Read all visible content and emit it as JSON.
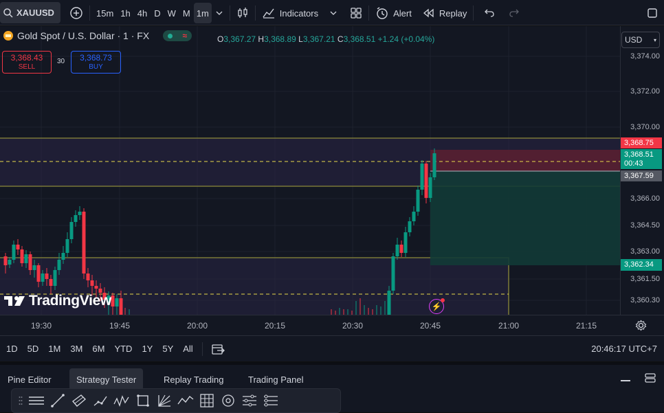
{
  "toolbar": {
    "symbol": "XAUUSD",
    "intervals": [
      "15m",
      "1h",
      "4h",
      "D",
      "W",
      "M",
      "1m"
    ],
    "indicators_label": "Indicators",
    "alert_label": "Alert",
    "replay_label": "Replay"
  },
  "legend": {
    "title": "Gold Spot / U.S. Dollar · 1 · FX",
    "o_label": "O",
    "o_value": "3,367.27",
    "h_label": "H",
    "h_value": "3,368.89",
    "l_label": "L",
    "l_value": "3,367.21",
    "c_label": "C",
    "c_value": "3,368.51",
    "change": "+1.24 (+0.04%)"
  },
  "trade": {
    "sell_price": "3,368.43",
    "sell_label": "SELL",
    "spread": "30",
    "buy_price": "3,368.73",
    "buy_label": "BUY"
  },
  "currency": "USD",
  "price_axis": {
    "labels": [
      "3,374.00",
      "3,372.00",
      "3,370.00",
      "3,366.00",
      "3,364.50",
      "3,363.00",
      "3,361.50",
      "3,360.30"
    ],
    "badge_red": "3,368.75",
    "badge_green_price": "3,368.51",
    "badge_green_timer": "00:43",
    "badge_gray": "3,367.59",
    "badge_teal": "3,362.34"
  },
  "time_axis": [
    "19:30",
    "19:45",
    "20:00",
    "20:15",
    "20:30",
    "20:45",
    "21:00",
    "21:15"
  ],
  "watermark": "TradingView",
  "ranges": [
    "1D",
    "5D",
    "1M",
    "3M",
    "6M",
    "YTD",
    "1Y",
    "5Y",
    "All"
  ],
  "clock": "20:46:17 UTC+7",
  "panel_tabs": [
    "Pine Editor",
    "Strategy Tester",
    "Replay Trading",
    "Trading Panel"
  ],
  "colors": {
    "up": "#089981",
    "down": "#f23645",
    "accent": "#2962ff",
    "background": "#131722"
  }
}
